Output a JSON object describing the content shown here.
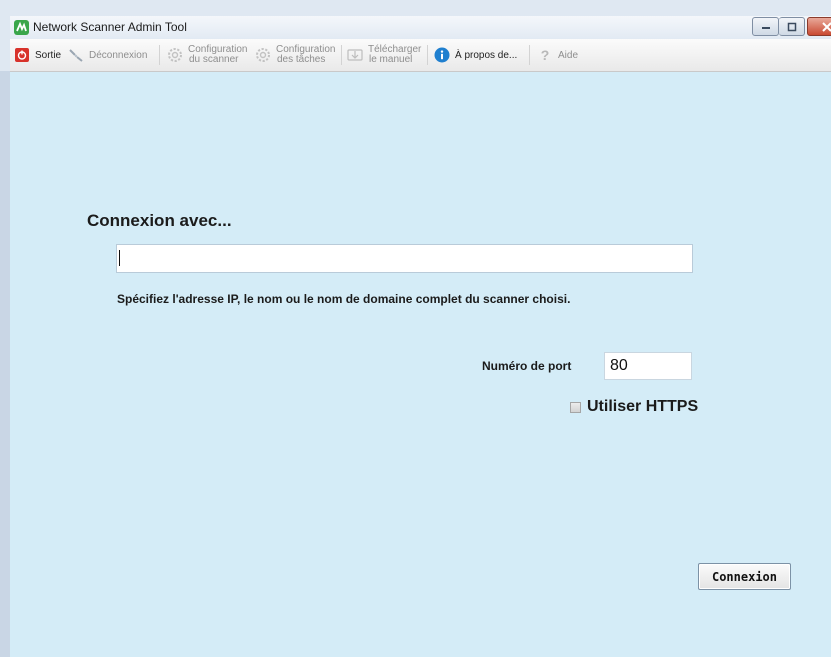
{
  "window": {
    "title": "Network Scanner Admin Tool",
    "colors": {
      "content_bg": "#d4ecf7",
      "close_button": "#c94a32"
    }
  },
  "toolbar": {
    "items": [
      {
        "icon": "power-icon",
        "label_line1": "Sortie",
        "label_line2": "",
        "enabled": true
      },
      {
        "icon": "disconnect-icon",
        "label_line1": "Déconnexion",
        "label_line2": "",
        "enabled": false
      },
      {
        "icon": "gear-icon",
        "label_line1": "Configuration",
        "label_line2": "du scanner",
        "enabled": false
      },
      {
        "icon": "gear-icon",
        "label_line1": "Configuration",
        "label_line2": "des tâches",
        "enabled": false
      },
      {
        "icon": "download-icon",
        "label_line1": "Télécharger",
        "label_line2": "le manuel",
        "enabled": false
      },
      {
        "icon": "info-icon",
        "label_line1": "À propos de...",
        "label_line2": "",
        "enabled": true
      },
      {
        "icon": "help-icon",
        "label_line1": "Aide",
        "label_line2": "",
        "enabled": false
      }
    ]
  },
  "connection": {
    "heading": "Connexion avec...",
    "host_value": "",
    "helper_text": "Spécifiez l'adresse IP, le nom ou le nom de domaine complet du scanner choisi.",
    "port_label": "Numéro de port",
    "port_value": "80",
    "https_label": "Utiliser HTTPS",
    "https_checked": false,
    "connect_label": "Connexion"
  }
}
